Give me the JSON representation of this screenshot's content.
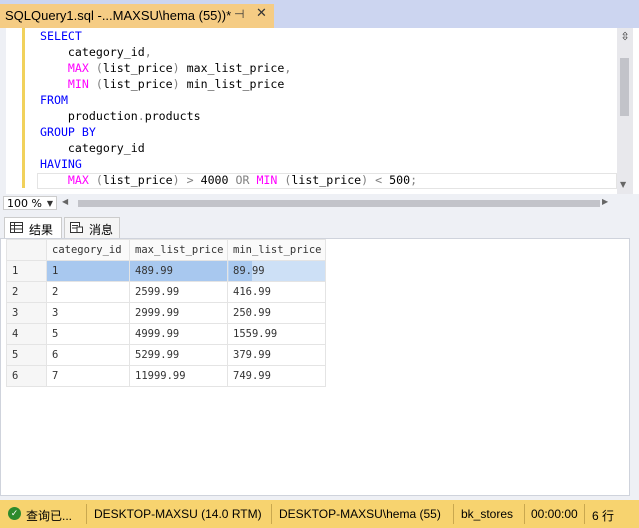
{
  "tab": {
    "title": "SQLQuery1.sql -...MAXSU\\hema (55))*",
    "pin": "⊣",
    "close": "✕"
  },
  "editor": {
    "lines": [
      [
        {
          "t": "SELECT",
          "c": "kw"
        }
      ],
      [
        {
          "t": "    category_id",
          "c": "tx"
        },
        {
          "t": ",",
          "c": "gr"
        }
      ],
      [
        {
          "t": "    ",
          "c": "tx"
        },
        {
          "t": "MAX",
          "c": "fn"
        },
        {
          "t": " (",
          "c": "gr"
        },
        {
          "t": "list_price",
          "c": "tx"
        },
        {
          "t": ")",
          "c": "gr"
        },
        {
          "t": " max_list_price",
          "c": "tx"
        },
        {
          "t": ",",
          "c": "gr"
        }
      ],
      [
        {
          "t": "    ",
          "c": "tx"
        },
        {
          "t": "MIN",
          "c": "fn"
        },
        {
          "t": " (",
          "c": "gr"
        },
        {
          "t": "list_price",
          "c": "tx"
        },
        {
          "t": ")",
          "c": "gr"
        },
        {
          "t": " min_list_price",
          "c": "tx"
        }
      ],
      [
        {
          "t": "FROM",
          "c": "kw"
        }
      ],
      [
        {
          "t": "    production",
          "c": "tx"
        },
        {
          "t": ".",
          "c": "gr"
        },
        {
          "t": "products",
          "c": "tx"
        }
      ],
      [
        {
          "t": "GROUP BY",
          "c": "kw"
        }
      ],
      [
        {
          "t": "    category_id",
          "c": "tx"
        }
      ],
      [
        {
          "t": "HAVING",
          "c": "kw"
        }
      ],
      [
        {
          "t": "    ",
          "c": "tx"
        },
        {
          "t": "MAX",
          "c": "fn"
        },
        {
          "t": " (",
          "c": "gr"
        },
        {
          "t": "list_price",
          "c": "tx"
        },
        {
          "t": ")",
          "c": "gr"
        },
        {
          "t": " > ",
          "c": "gr"
        },
        {
          "t": "4000",
          "c": "tx"
        },
        {
          "t": " OR ",
          "c": "gr"
        },
        {
          "t": "MIN",
          "c": "fn"
        },
        {
          "t": " (",
          "c": "gr"
        },
        {
          "t": "list_price",
          "c": "tx"
        },
        {
          "t": ")",
          "c": "gr"
        },
        {
          "t": " < ",
          "c": "gr"
        },
        {
          "t": "500",
          "c": "tx"
        },
        {
          "t": ";",
          "c": "gr"
        }
      ]
    ]
  },
  "zoom": {
    "value": "100 %"
  },
  "results_tabs": {
    "results": "结果",
    "messages": "消息"
  },
  "grid": {
    "columns": [
      "category_id",
      "max_list_price",
      "min_list_price"
    ],
    "rows": [
      [
        "1",
        "1",
        "489.99",
        "89.99"
      ],
      [
        "2",
        "2",
        "2599.99",
        "416.99"
      ],
      [
        "3",
        "3",
        "2999.99",
        "250.99"
      ],
      [
        "4",
        "5",
        "4999.99",
        "1559.99"
      ],
      [
        "5",
        "6",
        "5299.99",
        "379.99"
      ],
      [
        "6",
        "7",
        "11999.99",
        "749.99"
      ]
    ]
  },
  "status": {
    "state": "查询已...",
    "server": "DESKTOP-MAXSU (14.0 RTM)",
    "user": "DESKTOP-MAXSU\\hema (55)",
    "database": "bk_stores",
    "elapsed": "00:00:00",
    "rows": "6 行"
  },
  "colors": {
    "tab_active": "#f5cc84",
    "status_bar": "#f7d36f",
    "keyword": "#0000ff",
    "function": "#ff00ff",
    "operator": "#808080",
    "selection": "#a8c8ef"
  }
}
